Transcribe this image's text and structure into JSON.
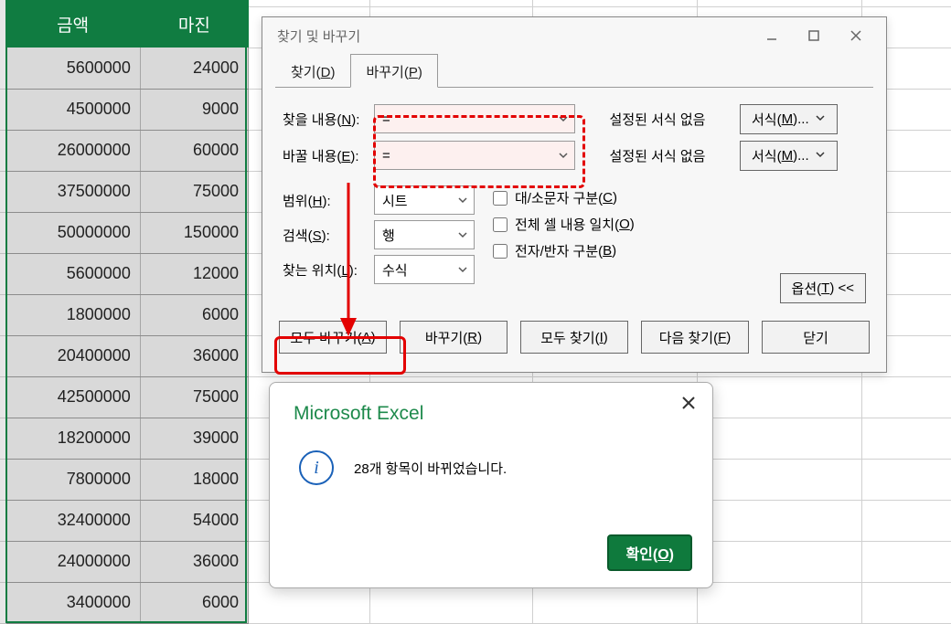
{
  "sheet": {
    "headers": [
      "금액",
      "마진"
    ],
    "rows": [
      [
        "5600000",
        "24000"
      ],
      [
        "4500000",
        "9000"
      ],
      [
        "26000000",
        "60000"
      ],
      [
        "37500000",
        "75000"
      ],
      [
        "50000000",
        "150000"
      ],
      [
        "5600000",
        "12000"
      ],
      [
        "1800000",
        "6000"
      ],
      [
        "20400000",
        "36000"
      ],
      [
        "42500000",
        "75000"
      ],
      [
        "18200000",
        "39000"
      ],
      [
        "7800000",
        "18000"
      ],
      [
        "32400000",
        "54000"
      ],
      [
        "24000000",
        "36000"
      ],
      [
        "3400000",
        "6000"
      ]
    ]
  },
  "dialog": {
    "title": "찾기 및 바꾸기",
    "tabs": {
      "find": "찾기(D)",
      "find_u": "D",
      "replace": "바꾸기(P)",
      "replace_u": "P"
    },
    "find_label": "찾을 내용(N):",
    "find_u": "N",
    "replace_label": "바꿀 내용(E):",
    "replace_u": "E",
    "find_val": "=",
    "replace_val": "=",
    "fmt_none": "설정된 서식 없음",
    "fmt_btn": "서식(M)...",
    "fmt_u": "M",
    "scope_label": "범위(H):",
    "scope_u": "H",
    "scope_val": "시트",
    "search_label": "검색(S):",
    "search_u": "S",
    "search_val": "행",
    "lookin_label": "찾는 위치(L):",
    "lookin_u": "L",
    "lookin_val": "수식",
    "chk_case": "대/소문자 구분(C)",
    "chk_case_u": "C",
    "chk_whole": "전체 셀 내용 일치(O)",
    "chk_whole_u": "O",
    "chk_width": "전자/반자 구분(B)",
    "chk_width_u": "B",
    "options_btn": "옵션(T) <<",
    "options_u": "T",
    "buttons": {
      "replace_all": "모두 바꾸기(A)",
      "replace_all_u": "A",
      "replace": "바꾸기(R)",
      "replace_u": "R",
      "find_all": "모두 찾기(I)",
      "find_all_u": "I",
      "find_next": "다음 찾기(F)",
      "find_next_u": "F",
      "close": "닫기"
    }
  },
  "msgbox": {
    "title": "Microsoft Excel",
    "body": "28개 항목이 바뀌었습니다.",
    "ok": "확인(O)",
    "ok_u": "O"
  }
}
